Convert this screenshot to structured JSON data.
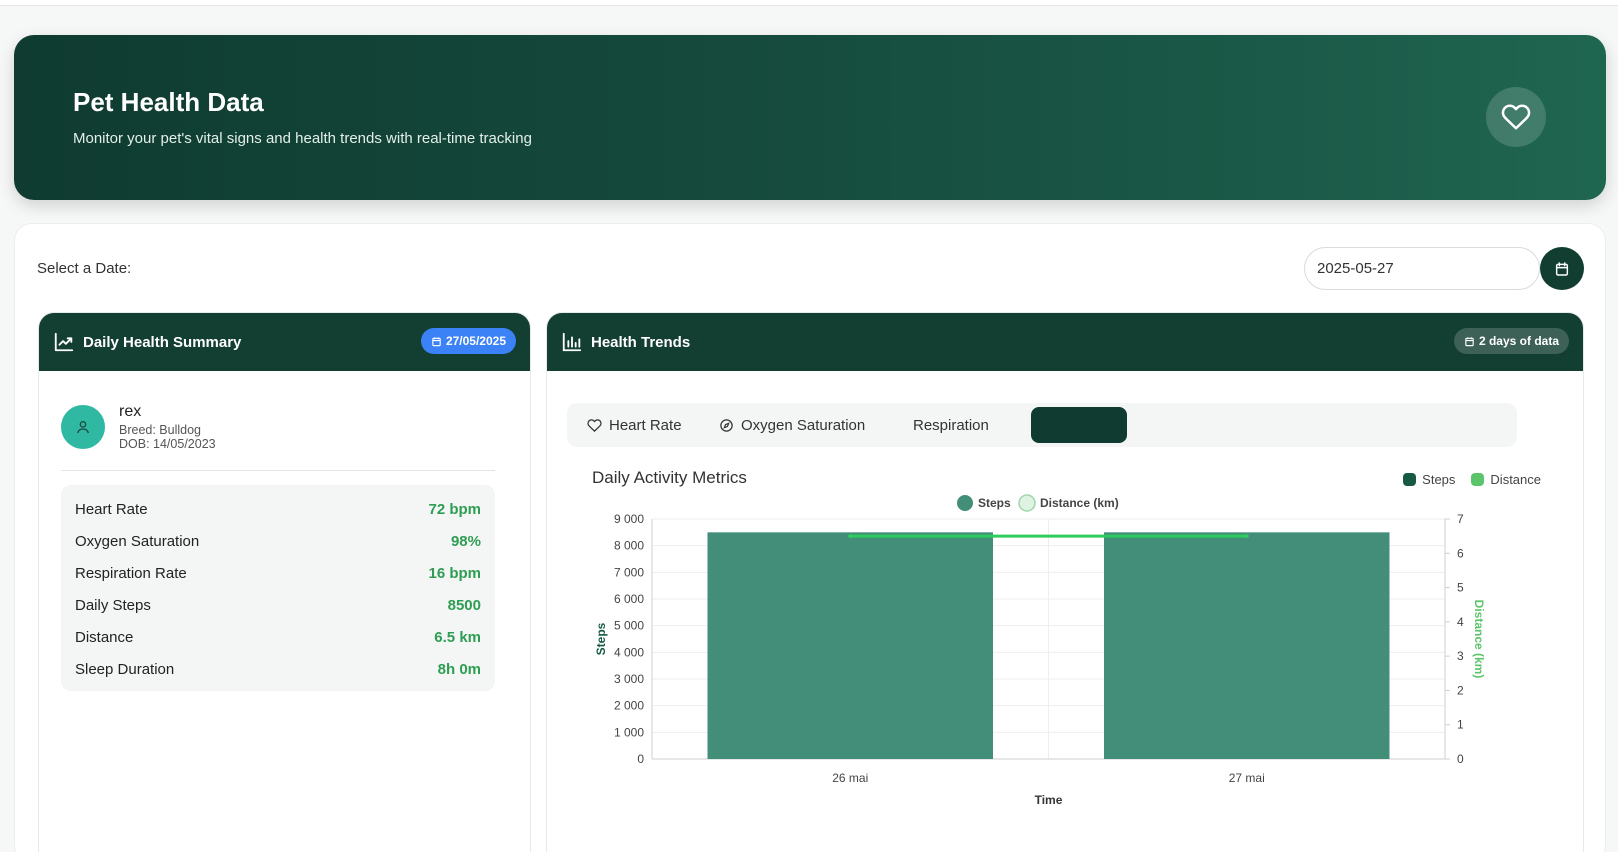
{
  "header": {
    "title": "Pet Health Data",
    "subtitle": "Monitor your pet's vital signs and health trends with real-time tracking",
    "icon": "heart-icon"
  },
  "date_picker": {
    "label": "Select a Date:",
    "value": "2025-05-27",
    "icon": "calendar-icon"
  },
  "summary": {
    "title": "Daily Health Summary",
    "date_badge": "27/05/2025",
    "pet": {
      "name": "rex",
      "breed": "Breed: Bulldog",
      "dob": "DOB: 14/05/2023"
    },
    "stats": [
      {
        "label": "Heart Rate",
        "value": "72 bpm"
      },
      {
        "label": "Oxygen Saturation",
        "value": "98%"
      },
      {
        "label": "Respiration Rate",
        "value": "16 bpm"
      },
      {
        "label": "Daily Steps",
        "value": "8500"
      },
      {
        "label": "Distance",
        "value": "6.5 km"
      },
      {
        "label": "Sleep Duration",
        "value": "8h 0m"
      }
    ]
  },
  "trends": {
    "title": "Health Trends",
    "badge": "2 days of data",
    "tabs": [
      {
        "label": "Heart Rate",
        "icon": "heart-icon"
      },
      {
        "label": "Oxygen Saturation",
        "icon": "compass-icon"
      },
      {
        "label": "Respiration",
        "icon": ""
      },
      {
        "label": "",
        "icon": "",
        "active": true
      }
    ],
    "chart_title": "Daily Activity Metrics",
    "legend_top": [
      {
        "label": "Steps",
        "color": "#165a45"
      },
      {
        "label": "Distance",
        "color": "#5cc46b"
      }
    ]
  },
  "colors": {
    "accent": "#133e32",
    "bar": "#428e78",
    "line": "#2ecc5e",
    "stat_value": "#2e9d52",
    "badge_blue": "#3b82f6"
  },
  "chart_data": {
    "type": "bar",
    "categories": [
      "26 mai",
      "27 mai"
    ],
    "series": [
      {
        "name": "Steps",
        "type": "bar",
        "axis": "left",
        "values": [
          8500,
          8500
        ]
      },
      {
        "name": "Distance (km)",
        "type": "line",
        "axis": "right",
        "values": [
          6.5,
          6.5
        ]
      }
    ],
    "legend": [
      "Steps",
      "Distance (km)"
    ],
    "xlabel": "Time",
    "ylabel": "Steps",
    "y2label": "Distance (km)",
    "ylim": [
      0,
      9000
    ],
    "y2lim": [
      0,
      7
    ],
    "yticks": [
      "9 000",
      "8 000",
      "7 000",
      "6 000",
      "5 000",
      "4 000",
      "3 000",
      "2 000",
      "1 000",
      "0"
    ],
    "y2ticks": [
      "7",
      "6",
      "5",
      "4",
      "3",
      "2",
      "1",
      "0"
    ],
    "grid": true
  }
}
